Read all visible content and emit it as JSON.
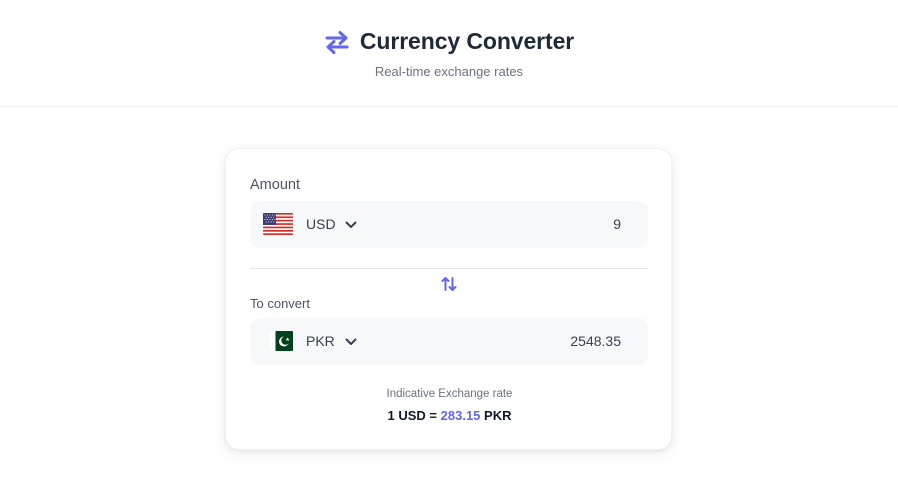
{
  "header": {
    "title": "Currency Converter",
    "subtitle": "Real-time exchange rates",
    "icon": "swap-horizontal-icon",
    "accent_color": "#6366f1"
  },
  "converter": {
    "amount_label": "Amount",
    "from": {
      "currency": "USD",
      "flag": "us-flag-icon",
      "value": "9"
    },
    "swap_icon": "swap-vertical-icon",
    "convert_label": "To convert",
    "to": {
      "currency": "PKR",
      "flag": "pk-flag-icon",
      "value": "2548.35"
    },
    "rate": {
      "caption": "Indicative Exchange rate",
      "base": "1 USD =",
      "value": "283.15",
      "quote": "PKR"
    }
  }
}
